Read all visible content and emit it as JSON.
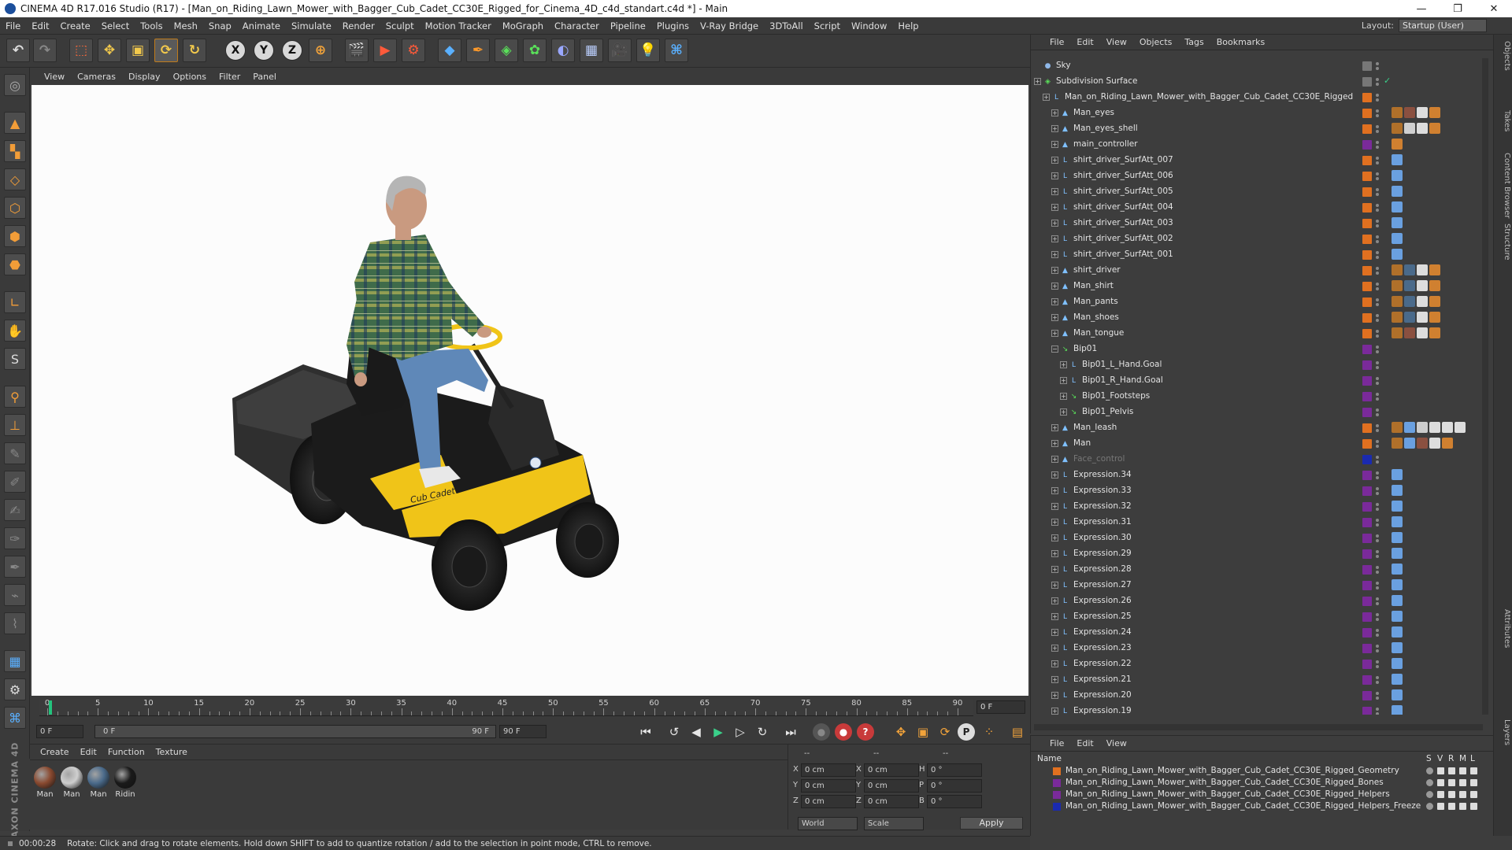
{
  "window": {
    "title": "CINEMA 4D R17.016 Studio (R17) - [Man_on_Riding_Lawn_Mower_with_Bagger_Cub_Cadet_CC30E_Rigged_for_Cinema_4D_c4d_standart.c4d *] - Main",
    "minimize": "—",
    "restore": "❐",
    "close": "✕"
  },
  "menubar": [
    "File",
    "Edit",
    "Create",
    "Select",
    "Tools",
    "Mesh",
    "Snap",
    "Animate",
    "Simulate",
    "Render",
    "Sculpt",
    "Motion Tracker",
    "MoGraph",
    "Character",
    "Pipeline",
    "Plugins",
    "V-Ray Bridge",
    "3DToAll",
    "Script",
    "Window",
    "Help"
  ],
  "layout": {
    "label": "Layout:",
    "value": "Startup (User)"
  },
  "viewport_menu": [
    "View",
    "Cameras",
    "Display",
    "Options",
    "Filter",
    "Panel"
  ],
  "timeline": {
    "ticks": [
      0,
      5,
      10,
      15,
      20,
      25,
      30,
      35,
      40,
      45,
      50,
      55,
      60,
      65,
      70,
      75,
      80,
      85,
      90
    ],
    "current_frame": "0 F"
  },
  "transport": {
    "start_field": "0 F",
    "range_start": "0 F",
    "range_end": "90 F",
    "end_field": "90 F"
  },
  "materials": {
    "menu": [
      "Create",
      "Edit",
      "Function",
      "Texture"
    ],
    "items": [
      {
        "label": "Man",
        "color": "#8a4a30"
      },
      {
        "label": "Man",
        "color": "#cfcfcf"
      },
      {
        "label": "Man",
        "color": "#4a6a8a"
      },
      {
        "label": "Ridin",
        "color": "#1a1a1a"
      }
    ]
  },
  "coordinates": {
    "header": [
      "--",
      "--",
      "--"
    ],
    "rows": [
      {
        "a": "X",
        "v1": "0 cm",
        "b": "X",
        "v2": "0 cm",
        "c": "H",
        "v3": "0 °"
      },
      {
        "a": "Y",
        "v1": "0 cm",
        "b": "Y",
        "v2": "0 cm",
        "c": "P",
        "v3": "0 °"
      },
      {
        "a": "Z",
        "v1": "0 cm",
        "b": "Z",
        "v2": "0 cm",
        "c": "B",
        "v3": "0 °"
      }
    ],
    "mode1": "World",
    "mode2": "Scale",
    "apply": "Apply"
  },
  "brand": "MAXON CINEMA 4D",
  "status": {
    "time": "00:00:28",
    "message": "Rotate: Click and drag to rotate elements. Hold down SHIFT to add to quantize rotation / add to the selection in point mode, CTRL to remove."
  },
  "objects_menu": [
    "File",
    "Edit",
    "View",
    "Objects",
    "Tags",
    "Bookmarks"
  ],
  "objects": [
    {
      "name": "Sky",
      "indent": 0,
      "icon": "sky",
      "layer": "#777777",
      "tags": []
    },
    {
      "name": "Subdivision Surface",
      "indent": 0,
      "icon": "subdiv",
      "layer": "#777777",
      "tags": [],
      "check": true
    },
    {
      "name": "Man_on_Riding_Lawn_Mower_with_Bagger_Cub_Cadet_CC30E_Rigged",
      "indent": 1,
      "icon": "null",
      "layer": "#e07020",
      "tags": []
    },
    {
      "name": "Man_eyes",
      "indent": 2,
      "icon": "joint",
      "layer": "#e07020",
      "tags": [
        "#b0702a",
        "#8a5040",
        "#dddddd",
        "#d08030"
      ]
    },
    {
      "name": "Man_eyes_shell",
      "indent": 2,
      "icon": "joint",
      "layer": "#e07020",
      "tags": [
        "#b0702a",
        "#d0d0d0",
        "#dddddd",
        "#d08030"
      ]
    },
    {
      "name": "main_controller",
      "indent": 2,
      "icon": "joint",
      "layer": "#7a2a9a",
      "tags": [
        "#d08030"
      ]
    },
    {
      "name": "shirt_driver_SurfAtt_007",
      "indent": 2,
      "icon": "null",
      "layer": "#e07020",
      "tags": [
        "#6aa0e0"
      ]
    },
    {
      "name": "shirt_driver_SurfAtt_006",
      "indent": 2,
      "icon": "null",
      "layer": "#e07020",
      "tags": [
        "#6aa0e0"
      ]
    },
    {
      "name": "shirt_driver_SurfAtt_005",
      "indent": 2,
      "icon": "null",
      "layer": "#e07020",
      "tags": [
        "#6aa0e0"
      ]
    },
    {
      "name": "shirt_driver_SurfAtt_004",
      "indent": 2,
      "icon": "null",
      "layer": "#e07020",
      "tags": [
        "#6aa0e0"
      ]
    },
    {
      "name": "shirt_driver_SurfAtt_003",
      "indent": 2,
      "icon": "null",
      "layer": "#e07020",
      "tags": [
        "#6aa0e0"
      ]
    },
    {
      "name": "shirt_driver_SurfAtt_002",
      "indent": 2,
      "icon": "null",
      "layer": "#e07020",
      "tags": [
        "#6aa0e0"
      ]
    },
    {
      "name": "shirt_driver_SurfAtt_001",
      "indent": 2,
      "icon": "null",
      "layer": "#e07020",
      "tags": [
        "#6aa0e0"
      ]
    },
    {
      "name": "shirt_driver",
      "indent": 2,
      "icon": "joint",
      "layer": "#e07020",
      "tags": [
        "#b0702a",
        "#4a6a8a",
        "#dddddd",
        "#d08030"
      ]
    },
    {
      "name": "Man_shirt",
      "indent": 2,
      "icon": "joint",
      "layer": "#e07020",
      "tags": [
        "#b0702a",
        "#4a6a8a",
        "#dddddd",
        "#d08030"
      ]
    },
    {
      "name": "Man_pants",
      "indent": 2,
      "icon": "joint",
      "layer": "#e07020",
      "tags": [
        "#b0702a",
        "#4a6a8a",
        "#dddddd",
        "#d08030"
      ]
    },
    {
      "name": "Man_shoes",
      "indent": 2,
      "icon": "joint",
      "layer": "#e07020",
      "tags": [
        "#b0702a",
        "#4a6a8a",
        "#dddddd",
        "#d08030"
      ]
    },
    {
      "name": "Man_tongue",
      "indent": 2,
      "icon": "joint",
      "layer": "#e07020",
      "tags": [
        "#b0702a",
        "#8a5040",
        "#dddddd",
        "#d08030"
      ]
    },
    {
      "name": "Bip01",
      "indent": 2,
      "icon": "bone",
      "layer": "#7a2a9a",
      "tags": [],
      "open": true
    },
    {
      "name": "Bip01_L_Hand.Goal",
      "indent": 3,
      "icon": "null",
      "layer": "#7a2a9a",
      "tags": []
    },
    {
      "name": "Bip01_R_Hand.Goal",
      "indent": 3,
      "icon": "null",
      "layer": "#7a2a9a",
      "tags": []
    },
    {
      "name": "Bip01_Footsteps",
      "indent": 3,
      "icon": "bone",
      "layer": "#7a2a9a",
      "tags": []
    },
    {
      "name": "Bip01_Pelvis",
      "indent": 3,
      "icon": "bone",
      "layer": "#7a2a9a",
      "tags": []
    },
    {
      "name": "Man_leash",
      "indent": 2,
      "icon": "joint",
      "layer": "#e07020",
      "tags": [
        "#b0702a",
        "#6aa0e0",
        "#cccccc",
        "#dddddd",
        "#dddddd",
        "#dddddd"
      ]
    },
    {
      "name": "Man",
      "indent": 2,
      "icon": "joint",
      "layer": "#e07020",
      "tags": [
        "#b0702a",
        "#6aa0e0",
        "#8a5040",
        "#dddddd",
        "#d08030"
      ]
    },
    {
      "name": "Face_control",
      "indent": 2,
      "icon": "joint",
      "layer": "#1a2ab0",
      "tags": [],
      "dim": true
    },
    {
      "name": "Expression.34",
      "indent": 2,
      "icon": "null",
      "layer": "#7a2a9a",
      "tags": [
        "#6aa0e0"
      ]
    },
    {
      "name": "Expression.33",
      "indent": 2,
      "icon": "null",
      "layer": "#7a2a9a",
      "tags": [
        "#6aa0e0"
      ]
    },
    {
      "name": "Expression.32",
      "indent": 2,
      "icon": "null",
      "layer": "#7a2a9a",
      "tags": [
        "#6aa0e0"
      ]
    },
    {
      "name": "Expression.31",
      "indent": 2,
      "icon": "null",
      "layer": "#7a2a9a",
      "tags": [
        "#6aa0e0"
      ]
    },
    {
      "name": "Expression.30",
      "indent": 2,
      "icon": "null",
      "layer": "#7a2a9a",
      "tags": [
        "#6aa0e0"
      ]
    },
    {
      "name": "Expression.29",
      "indent": 2,
      "icon": "null",
      "layer": "#7a2a9a",
      "tags": [
        "#6aa0e0"
      ]
    },
    {
      "name": "Expression.28",
      "indent": 2,
      "icon": "null",
      "layer": "#7a2a9a",
      "tags": [
        "#6aa0e0"
      ]
    },
    {
      "name": "Expression.27",
      "indent": 2,
      "icon": "null",
      "layer": "#7a2a9a",
      "tags": [
        "#6aa0e0"
      ]
    },
    {
      "name": "Expression.26",
      "indent": 2,
      "icon": "null",
      "layer": "#7a2a9a",
      "tags": [
        "#6aa0e0"
      ]
    },
    {
      "name": "Expression.25",
      "indent": 2,
      "icon": "null",
      "layer": "#7a2a9a",
      "tags": [
        "#6aa0e0"
      ]
    },
    {
      "name": "Expression.24",
      "indent": 2,
      "icon": "null",
      "layer": "#7a2a9a",
      "tags": [
        "#6aa0e0"
      ]
    },
    {
      "name": "Expression.23",
      "indent": 2,
      "icon": "null",
      "layer": "#7a2a9a",
      "tags": [
        "#6aa0e0"
      ]
    },
    {
      "name": "Expression.22",
      "indent": 2,
      "icon": "null",
      "layer": "#7a2a9a",
      "tags": [
        "#6aa0e0"
      ]
    },
    {
      "name": "Expression.21",
      "indent": 2,
      "icon": "null",
      "layer": "#7a2a9a",
      "tags": [
        "#6aa0e0"
      ]
    },
    {
      "name": "Expression.20",
      "indent": 2,
      "icon": "null",
      "layer": "#7a2a9a",
      "tags": [
        "#6aa0e0"
      ]
    },
    {
      "name": "Expression.19",
      "indent": 2,
      "icon": "null",
      "layer": "#7a2a9a",
      "tags": [
        "#6aa0e0"
      ]
    }
  ],
  "layers_menu": [
    "File",
    "Edit",
    "View"
  ],
  "layers_header": {
    "name": "Name",
    "cols": [
      "S",
      "V",
      "R",
      "M",
      "L"
    ]
  },
  "layers": [
    {
      "name": "Man_on_Riding_Lawn_Mower_with_Bagger_Cub_Cadet_CC30E_Rigged_Geometry",
      "color": "#e07020"
    },
    {
      "name": "Man_on_Riding_Lawn_Mower_with_Bagger_Cub_Cadet_CC30E_Rigged_Bones",
      "color": "#7a2a9a"
    },
    {
      "name": "Man_on_Riding_Lawn_Mower_with_Bagger_Cub_Cadet_CC30E_Rigged_Helpers",
      "color": "#7a2a9a"
    },
    {
      "name": "Man_on_Riding_Lawn_Mower_with_Bagger_Cub_Cadet_CC30E_Rigged_Helpers_Freeze",
      "color": "#1a2ab0"
    }
  ],
  "side_tabs": [
    "Objects",
    "Takes",
    "Content Browser",
    "Structure",
    "Attributes",
    "Layers"
  ],
  "scene": {
    "mower_brand": "Cub Cadet"
  }
}
